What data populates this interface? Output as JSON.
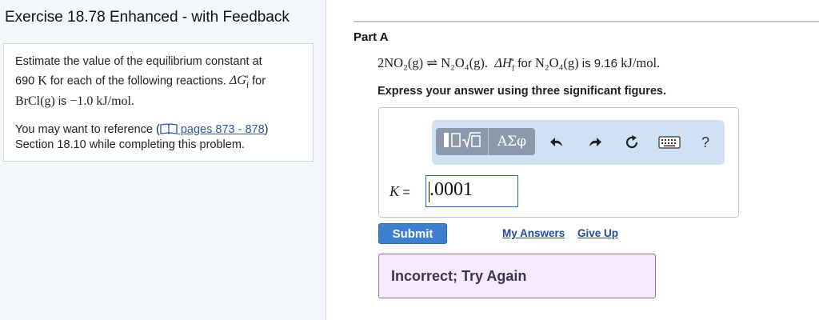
{
  "exercise": {
    "title": "Exercise 18.78 Enhanced - with Feedback"
  },
  "intro": {
    "line1": "Estimate the value of the equilibrium constant at",
    "temp_value": "690",
    "temp_unit": "K",
    "line2_rest": "for each of the following reactions.",
    "dg_symbol": "ΔG",
    "dg_sub": "f",
    "dg_sup": "∘",
    "for_text": "for",
    "compound": "BrCl(g)",
    "is_text": "is",
    "dg_value": "−1.0",
    "dg_unit": "kJ/mol",
    "ref_prefix": "You may want to reference (",
    "ref_link": " pages 873 - 878",
    "ref_suffix": ")",
    "ref_line2": "Section 18.10 while completing this problem."
  },
  "part": {
    "label": "Part A",
    "reaction_lhs": "2NO₂(g)",
    "arrow": "⇌",
    "reaction_rhs": "N₂O₄(g).",
    "dh_symbol": "ΔH",
    "dh_sub": "f",
    "dh_sup": "∘",
    "for_text": "for",
    "dh_compound": "N₂O₄(g)",
    "is_text": "is",
    "dh_value": "9.16",
    "dh_unit": "kJ/mol.",
    "instruction": "Express your answer using three significant figures."
  },
  "toolbar": {
    "templates_icon": "templates-icon",
    "symbols_label": "ΑΣφ",
    "undo_icon": "undo-icon",
    "redo_icon": "redo-icon",
    "reset_icon": "reset-icon",
    "keyboard_icon": "keyboard-icon",
    "help_label": "?"
  },
  "answer": {
    "variable": "K",
    "equals": "=",
    "value": ".0001"
  },
  "actions": {
    "submit_label": "Submit",
    "my_answers_label": "My Answers",
    "give_up_label": "Give Up"
  },
  "feedback": {
    "message": "Incorrect; Try Again"
  },
  "colors": {
    "submit_bg": "#3d7fd1",
    "link": "#234b9b",
    "feedback_bg": "#f5e9fb",
    "feedback_border": "#9c6bb6",
    "toolbar_bg": "#cfe1f2"
  }
}
